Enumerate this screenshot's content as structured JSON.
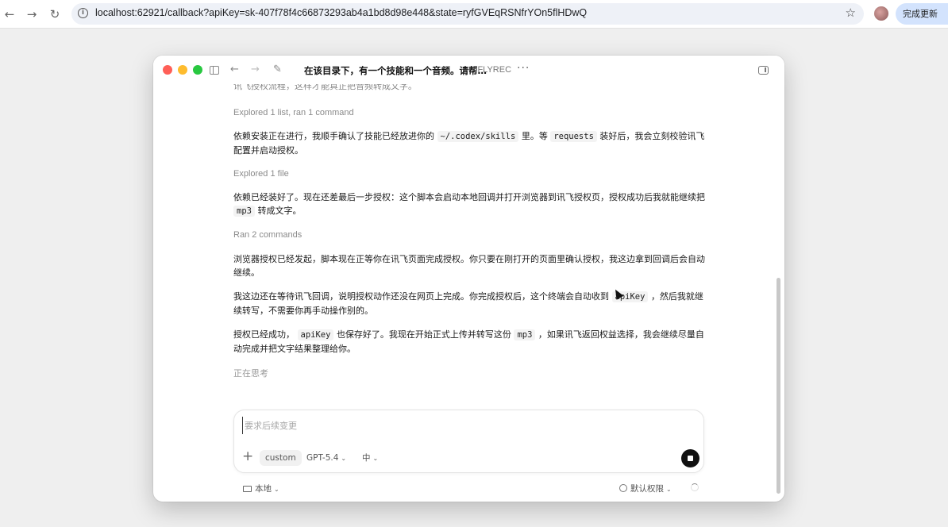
{
  "browser": {
    "url": "localhost:62921/callback?apiKey=sk-407f78f4c66873293ab4a1bd8d98e448&state=ryfGVEqRSNfrYOn5flHDwQ",
    "update_label": "完成更新",
    "back_icon": "arrow-left-icon",
    "forward_icon": "arrow-right-icon",
    "reload_icon": "reload-icon",
    "bookmark_icon": "star-icon"
  },
  "window": {
    "title": "在该目录下，有一个技能和一个音频。请帮…",
    "project": "iFLYREC",
    "more": "···"
  },
  "transcript": {
    "cut_line": "讯飞授权流程，这样才能真正把音频转成文字。",
    "events": [
      {
        "meta": "Explored 1 list, ran 1 command"
      },
      {
        "text_1": "依赖安装正在进行，我顺手确认了技能已经放进你的",
        "code_1": "~/.codex/skills",
        "text_2": "里。等",
        "code_2": "requests",
        "text_3": "装好后，我会立刻校验讯飞配置并启动授权。"
      },
      {
        "meta": "Explored 1 file"
      },
      {
        "text_1": "依赖已经装好了。现在还差最后一步授权：这个脚本会启动本地回调并打开浏览器到讯飞授权页，授权成功后我就能继续把",
        "code_1": "mp3",
        "text_2": "转成文字。"
      },
      {
        "meta": "Ran 2 commands"
      },
      {
        "text_1": "浏览器授权已经发起，脚本现在正等你在讯飞页面完成授权。你只要在刚打开的页面里确认授权，我这边拿到回调后会自动继续。"
      },
      {
        "text_1": "我这边还在等待讯飞回调，说明授权动作还没在网页上完成。你完成授权后，这个终端会自动收到",
        "code_1": "apiKey",
        "text_2": "，然后我就继续转写，不需要你再手动操作别的。"
      },
      {
        "text_1": "授权已经成功，",
        "code_1": "apiKey",
        "text_2": "也保存好了。我现在开始正式上传并转写这份",
        "code_2": "mp3",
        "text_3": "，如果讯飞返回权益选择，我会继续尽量自动完成并把文字结果整理给你。"
      }
    ],
    "thinking": "正在思考"
  },
  "composer": {
    "placeholder": "要求后续变更",
    "plus": "+",
    "custom_label": "custom",
    "model_label": "GPT-5.4",
    "effort_label": "中",
    "caret": "⌄"
  },
  "footer": {
    "env_label": "本地",
    "permission_label": "默认权限",
    "caret": "⌄"
  }
}
